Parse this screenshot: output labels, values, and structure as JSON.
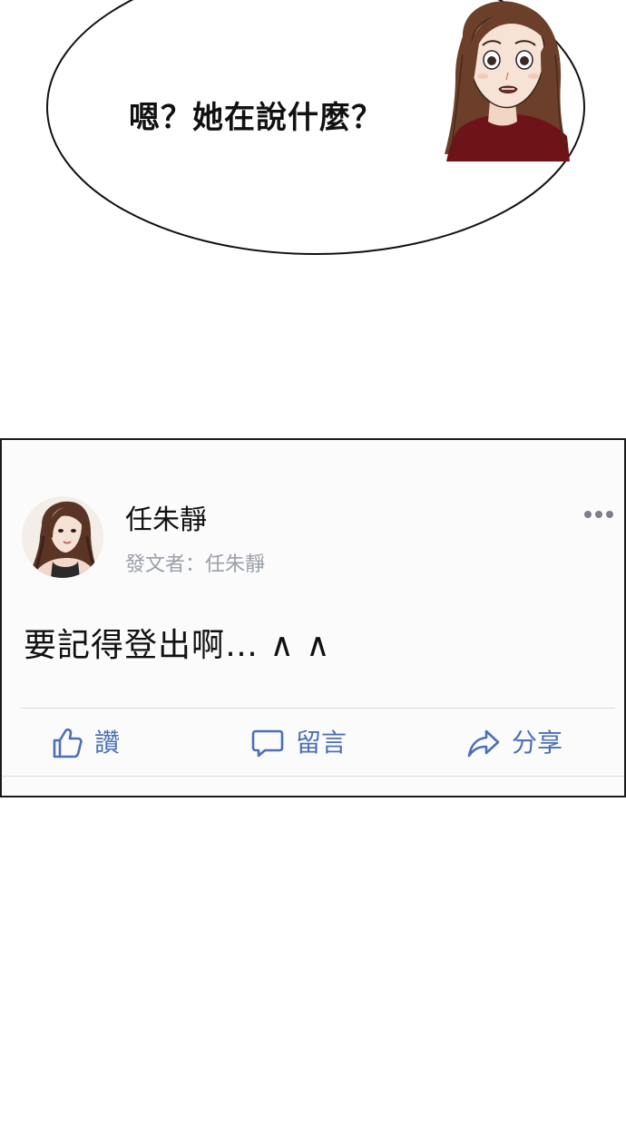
{
  "bubble": {
    "text": "嗯？她在說什麼？"
  },
  "post": {
    "author_name": "任朱靜",
    "author_sub": "發文者：任朱靜",
    "body": "要記得登出啊… ∧ ∧",
    "actions": {
      "like_label": "讚",
      "comment_label": "留言",
      "share_label": "分享"
    }
  },
  "colors": {
    "action_blue": "#4d70b5",
    "sub_text_gray": "#9a9fa8",
    "card_border": "#1a1a1a",
    "hair_brown": "#6b3f2a",
    "shirt_red": "#6e1418"
  },
  "icons": {
    "like": "thumbs-up-icon",
    "comment": "speech-bubble-icon",
    "share": "share-arrow-icon",
    "more": "more-dots-icon"
  }
}
